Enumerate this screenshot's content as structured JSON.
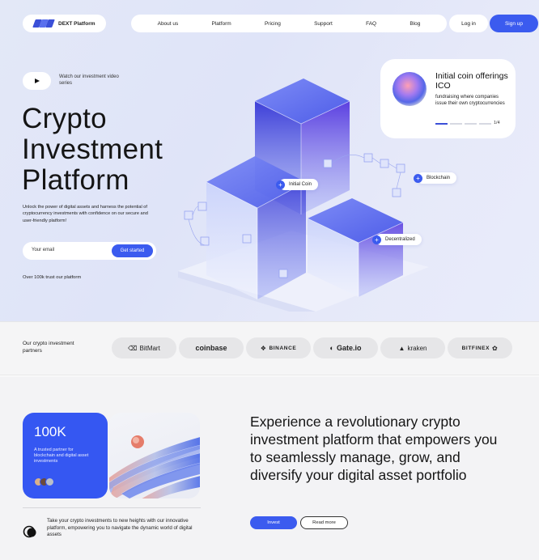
{
  "nav": {
    "brand": "DEXT Platform",
    "links": [
      "About us",
      "Platform",
      "Pricing",
      "Support",
      "FAQ",
      "Blog"
    ],
    "login": "Log in",
    "signup": "Sign up"
  },
  "hero": {
    "watch_text": "Watch our investment video series",
    "title_lines": [
      "Crypto",
      "Investment",
      "Platform"
    ],
    "description": "Unlock the power of digital assets and harness the potential of cryptocurrency investments with confidence on our secure and user-friendly platform!",
    "email_placeholder": "Your email",
    "cta": "Get started",
    "trust": "Over 100k trust our platform"
  },
  "ico_card": {
    "title": "Initial coin offerings ICO",
    "description": "fundraising where companies issue their own cryptocurrencies",
    "page": "1/4"
  },
  "scene_labels": {
    "initial_coin": "Initial Coin",
    "blockchain": "Blockchain",
    "decentralized": "Decentralized"
  },
  "partners": {
    "label": "Our crypto investment partners",
    "logos": [
      "BitMart",
      "coinbase",
      "BINANCE",
      "Gate.io",
      "kraken",
      "BITFINEX"
    ]
  },
  "stats": {
    "number": "100K",
    "description": "A trusted partner for blockchain and digital asset investments"
  },
  "lower": {
    "body_text": "Take your crypto investments to new heights with our innovative platform, empowering you to navigate the dynamic world of digital assets",
    "headline": "Experience a revolutionary crypto investment platform that empowers you to seamlessly manage, grow, and diversify your digital asset portfolio",
    "invest": "Invest",
    "read_more": "Read more"
  },
  "colors": {
    "accent": "#3b5bef",
    "hero_bg": "#e3e8f7",
    "card_blue": "#3557f2"
  }
}
